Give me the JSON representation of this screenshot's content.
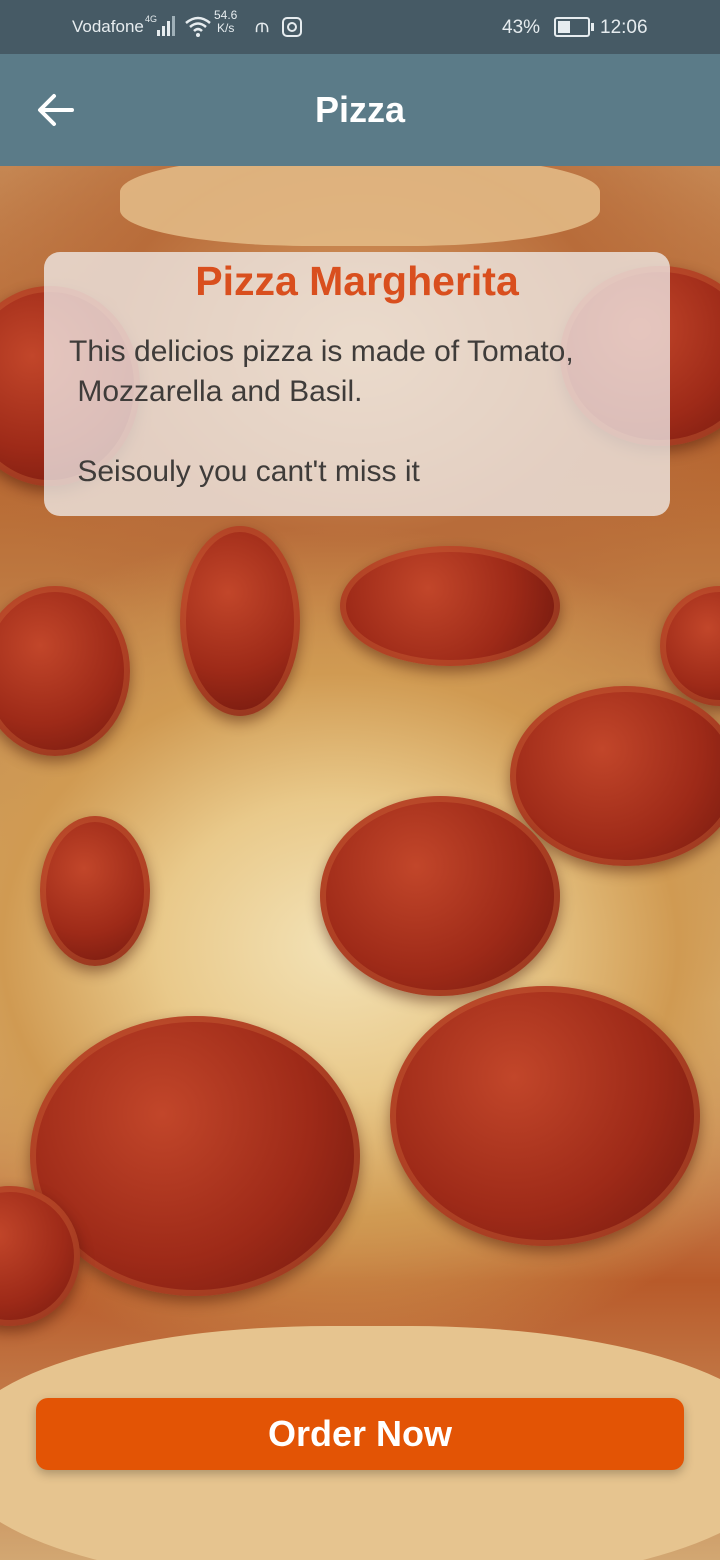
{
  "status_bar": {
    "carrier": "Vodafone",
    "network_type": "4G",
    "speed_value": "54.6",
    "speed_unit": "K/s",
    "battery_percent": "43%",
    "time": "12:06",
    "icons": [
      "signal-icon",
      "wifi-icon",
      "usb-icon",
      "instagram-icon",
      "battery-icon"
    ]
  },
  "app_bar": {
    "title": "Pizza",
    "back_icon": "arrow-back-icon"
  },
  "card": {
    "title": "Pizza Margherita",
    "description": "This delicios pizza is made of Tomato,\n Mozzarella and Basil.\n\n Seisouly you cant't miss it"
  },
  "order_button": {
    "label": "Order Now"
  },
  "colors": {
    "status_bar": "#465a65",
    "app_bar": "#5b7b88",
    "accent": "#e35405",
    "title": "#d94f1e"
  }
}
